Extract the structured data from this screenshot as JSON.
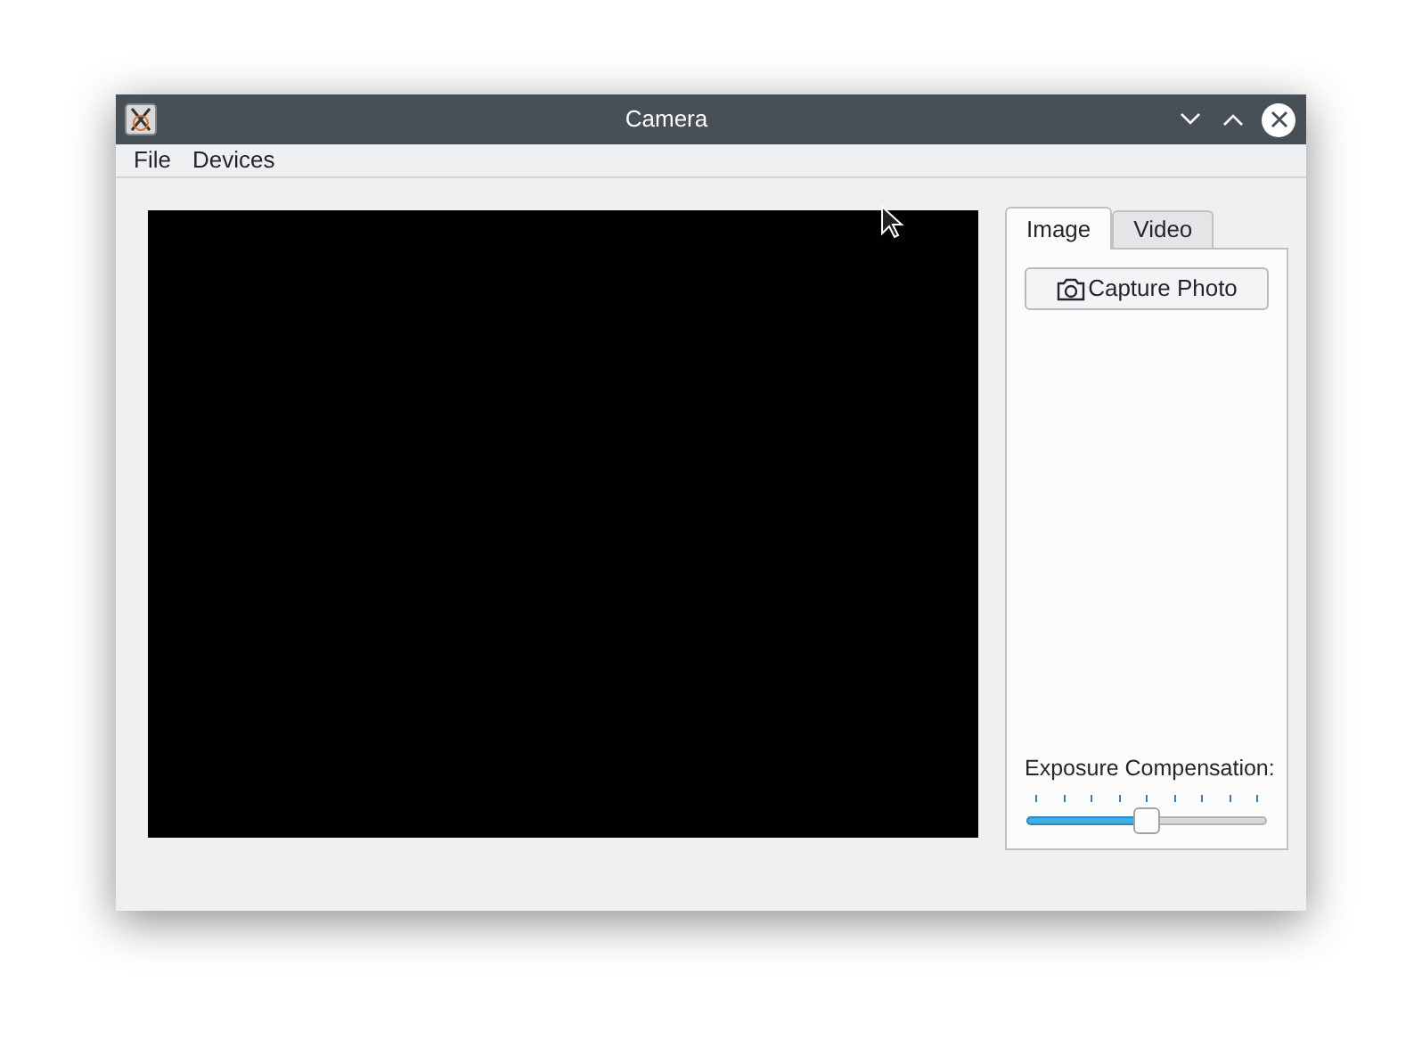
{
  "window": {
    "title": "Camera"
  },
  "menu": [
    "File",
    "Devices"
  ],
  "tabs": [
    {
      "label": "Image",
      "selected": true
    },
    {
      "label": "Video",
      "selected": false
    }
  ],
  "capture_button": "Capture Photo",
  "exposure": {
    "label": "Exposure Compensation:",
    "level": 0.5
  }
}
